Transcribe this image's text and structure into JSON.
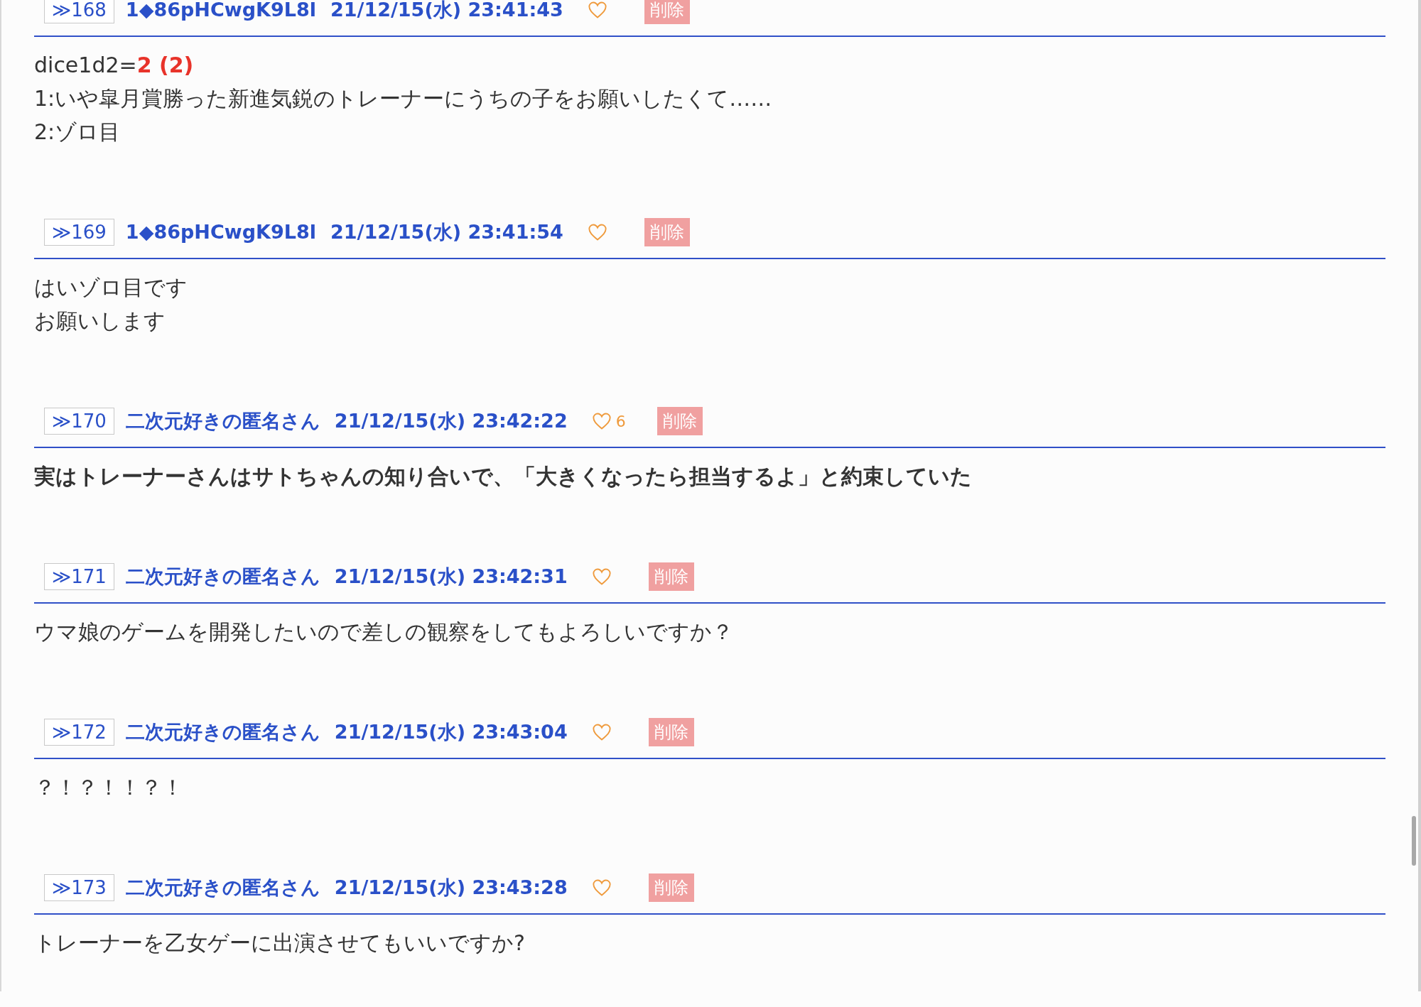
{
  "posts": [
    {
      "number": "≫168",
      "author": "1◆86pHCwgK9L8l",
      "date": "21/12/15(水) 23:41:43",
      "delete_label": "削除",
      "bold": false,
      "lines": [
        {
          "text": "dice1d2=",
          "dice_result": "2 (2)"
        },
        {
          "text": "1:いや皐月賞勝った新進気鋭のトレーナーにうちの子をお願いしたくて……"
        },
        {
          "text": "2:ゾロ目"
        }
      ]
    },
    {
      "number": "≫169",
      "author": "1◆86pHCwgK9L8l",
      "date": "21/12/15(水) 23:41:54",
      "delete_label": "削除",
      "bold": false,
      "lines": [
        {
          "text": "はいゾロ目です"
        },
        {
          "text": "お願いします"
        }
      ]
    },
    {
      "number": "≫170",
      "author": "二次元好きの匿名さん",
      "date": "21/12/15(水) 23:42:22",
      "like_count": "6",
      "delete_label": "削除",
      "bold": true,
      "lines": [
        {
          "text": "実はトレーナーさんはサトちゃんの知り合いで、「大きくなったら担当するよ」と約束していた"
        }
      ]
    },
    {
      "number": "≫171",
      "author": "二次元好きの匿名さん",
      "date": "21/12/15(水) 23:42:31",
      "delete_label": "削除",
      "bold": false,
      "lines": [
        {
          "text": "ウマ娘のゲームを開発したいので差しの観察をしてもよろしいですか？"
        }
      ]
    },
    {
      "number": "≫172",
      "author": "二次元好きの匿名さん",
      "date": "21/12/15(水) 23:43:04",
      "delete_label": "削除",
      "bold": false,
      "lines": [
        {
          "text": "？！？！！？！"
        }
      ]
    },
    {
      "number": "≫173",
      "author": "二次元好きの匿名さん",
      "date": "21/12/15(水) 23:43:28",
      "delete_label": "削除",
      "bold": false,
      "lines": [
        {
          "text": "トレーナーを乙女ゲーに出演させてもいいですか?"
        }
      ]
    }
  ]
}
